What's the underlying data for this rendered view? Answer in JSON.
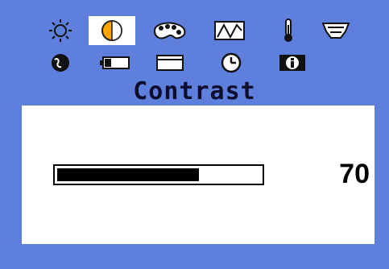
{
  "osd": {
    "title": "Contrast",
    "menu_icons_row1": [
      "brightness-icon",
      "contrast-icon",
      "color-palette-icon",
      "waveform-icon",
      "thermometer-icon",
      "adjust-icon"
    ],
    "menu_icons_row2": [
      "globe-icon",
      "battery-icon",
      "window-icon",
      "clock-icon",
      "info-icon"
    ],
    "selected_icon": "contrast-icon",
    "contrast": {
      "value": "70",
      "level_percent": 70
    },
    "colors": {
      "background": "#5e7fdc",
      "panel": "#ffffff",
      "selected_highlight": "#ffffff",
      "contrast_icon_fill": "#ffa500"
    }
  }
}
